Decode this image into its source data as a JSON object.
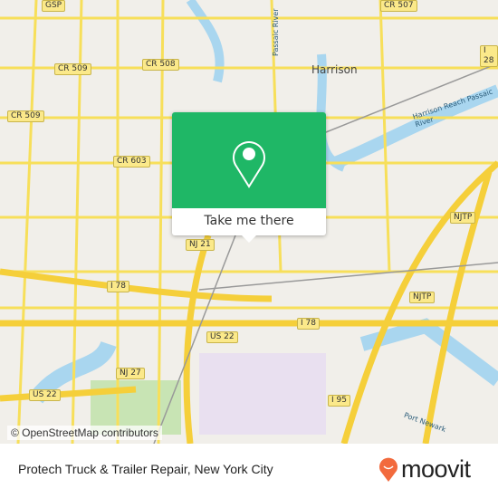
{
  "map": {
    "road_labels": [
      "GSP",
      "CR 507",
      "CR 509",
      "CR 508",
      "CR 509",
      "CR 603",
      "NJTP",
      "NJ 21",
      "NJTP",
      "I 78",
      "I 78",
      "US 22",
      "NJ 27",
      "US 22",
      "I 95",
      "I 28"
    ],
    "town_labels": [
      "Harrison"
    ],
    "water_labels": [
      "Passaic River",
      "Harrison Reach Passaic River",
      "Port Newark"
    ],
    "attribution": "© OpenStreetMap contributors",
    "colors": {
      "land": "#f1efea",
      "water": "#a9d6ef",
      "road": "#f7df5a",
      "park": "#c8e4b4"
    }
  },
  "popup": {
    "icon": "map-pin-icon",
    "button_label": "Take me there",
    "color": "#1fb766"
  },
  "footer": {
    "place_name": "Protech Truck & Trailer Repair, New York City",
    "brand": "moovit",
    "brand_color": "#f26a3d"
  }
}
